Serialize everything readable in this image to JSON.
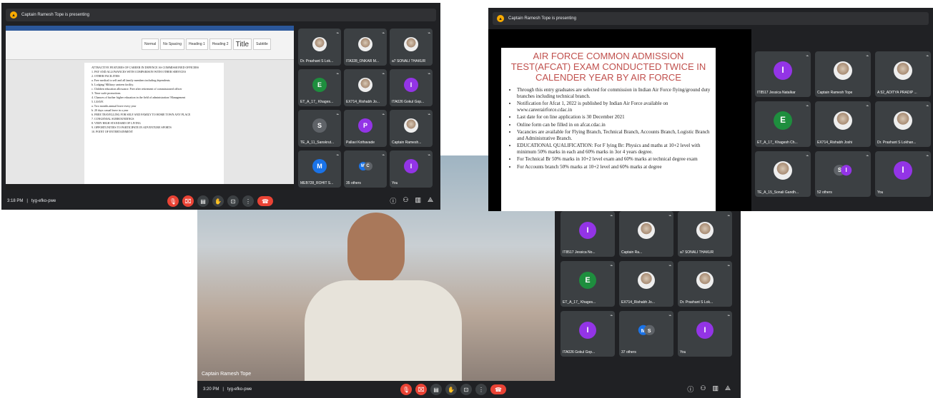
{
  "w1": {
    "presenter": "Captain Ramesh Tope is presenting",
    "time": "3:18 PM",
    "code": "tyg-efko-pwe",
    "doc_styles": [
      "Normal",
      "No Spacing",
      "Heading 1",
      "Heading 2",
      "Title",
      "Subtitle"
    ],
    "doc_lines": [
      "ATTRACTIVE FEATURES OF CAREER IN DEFENCE AS COMMISSIONED OFFICERS",
      "1. PAY AND ALLOWANCES WITH COMPARISON WITH OTHER SERVICES",
      "2. OTHER FACILITIES",
      "a. Free medical to self and all family members including dependents.",
      "b. Lodging/ Military canteen facility.",
      "c. Children education allowance. Free after retirement of commissioned officer",
      "3. Time scale promotions",
      "4. Chances of further higher education in the field of administration/ Management",
      "5. LEAVE",
      "a. Two months annual leave every year",
      "b. 20 days casual leave in a year",
      "6. FREE TRAVELLING FOR SELF AND FAMILY TO HOME TOWN ANY PLACE",
      "7. CONGENIAL SURROUNDINGS",
      "8. VERY HIGH STANDARD OF LIVING",
      "9. OPPORTUNITIES TO PARTICIPATE IN ADVENTURE SPORTS",
      "10. POINT OF ENTERTAINMENT"
    ],
    "tiles": [
      {
        "name": "Dr. Prashant S Lok..."
      },
      {
        "name": "ITA328_ONKAR M..."
      },
      {
        "name": "a7 SONALI THAKUR"
      },
      {
        "name": "ET_A_17_ Khages...",
        "letter": "E"
      },
      {
        "name": "EX714_Rishabh Jo..."
      },
      {
        "name": "ITA026 Gokul Gop...",
        "letter": "I"
      },
      {
        "name": "TE_A_11_Sanskrut...",
        "letter": "S"
      },
      {
        "name": "Pallavi Kothavade",
        "letter": "P"
      },
      {
        "name": "Captain Ramesh..."
      },
      {
        "name": "MEB728_ROHIT S...",
        "letter": "M"
      },
      {
        "name": "35 others",
        "letters": [
          "M",
          "C"
        ]
      },
      {
        "name": "You",
        "letter": "I"
      }
    ]
  },
  "w2": {
    "presenter": "Captain Ramesh Tope is presenting",
    "slide_title": "AIR FORCE COMMON ADMISSION TEST(AFCAT) EXAM CONDUCTED TWICE IN CALENDER YEAR BY AIR FORCE",
    "bullets": [
      "Through this entry graduates are selected for commission in Indian Air Force flying/ground duty branches including technical branch.",
      "Notification for Afcat 1, 2022 is published by Indian Air Force available on www.careerairforce.cdac.in",
      "Last date for on line application is 30 December 2021",
      "Online form can be filled in on afcat.cdac.in",
      "Vacancies are available for Flying Branch, Technical Branch, Accounts Branch, Logistic Branch and Administrative Branch.",
      "EDUCATIONAL QUALIFICATION: For F lying Br: Physics and maths at 10+2 level with minimum 50% marks in each and 60% marks in 3or 4 years degree.",
      "For Technical Br 50% marks in 10+2 level exam and 60% marks at technical degree exam",
      "For Accounts branch 50% marks at 10+2 level and 60% marks at degree"
    ],
    "tiles": [
      {
        "name": "IT8517 Jessica Natalkar",
        "letter": "I"
      },
      {
        "name": "Captain Ramesh Tope"
      },
      {
        "name": "A 52_ADITYA PRADIP ..."
      },
      {
        "name": "ET_A_17_ Khagesh Ch...",
        "letter": "E"
      },
      {
        "name": "EX714_Rishabh Joshi"
      },
      {
        "name": "Dr. Prashant S Lokhan..."
      },
      {
        "name": "TE_A_15_Sonali Gandh..."
      },
      {
        "name": "52 others",
        "letters": [
          "S",
          "I"
        ]
      },
      {
        "name": "You",
        "letter": "I"
      }
    ]
  },
  "w3": {
    "presenter": "Captain Ramesh Tope",
    "time": "3:20 PM",
    "code": "tyg-efko-pwe",
    "tiles": [
      {
        "name": "IT8517 Jessica No...",
        "letter": "I"
      },
      {
        "name": "Captain Ra..."
      },
      {
        "name": "a7 SONALI THAKUR"
      },
      {
        "name": "ET_A_17_ Khages...",
        "letter": "E"
      },
      {
        "name": "EX714_Rishabh Jo..."
      },
      {
        "name": "Dr. Prashant S Lok..."
      },
      {
        "name": "ITA026 Gokul Gop...",
        "letter": "I"
      },
      {
        "name": "37 others",
        "letters": [
          "M",
          "S"
        ]
      },
      {
        "name": "You",
        "letter": "I"
      }
    ]
  },
  "colors": {
    "purple": "#9334e6",
    "green": "#1e8e3e",
    "blue": "#1a73e8",
    "grey": "#5f6368",
    "end": "#ea4335"
  }
}
